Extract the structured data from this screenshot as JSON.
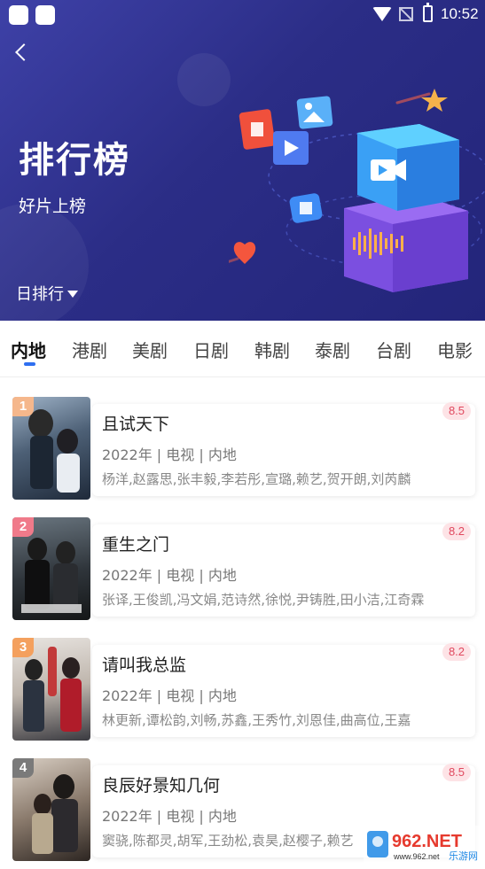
{
  "status_bar": {
    "time": "10:52"
  },
  "header": {
    "title": "排行榜",
    "subtitle": "好片上榜",
    "period_selector": "日排行"
  },
  "tabs": [
    {
      "label": "内地",
      "active": true
    },
    {
      "label": "港剧",
      "active": false
    },
    {
      "label": "美剧",
      "active": false
    },
    {
      "label": "日剧",
      "active": false
    },
    {
      "label": "韩剧",
      "active": false
    },
    {
      "label": "泰剧",
      "active": false
    },
    {
      "label": "台剧",
      "active": false
    },
    {
      "label": "电影",
      "active": false
    }
  ],
  "list": [
    {
      "rank": "1",
      "title": "且试天下",
      "meta": "2022年 | 电视 | 内地",
      "cast": "杨洋,赵露思,张丰毅,李若彤,宣璐,赖艺,贺开朗,刘芮麟",
      "score": "8.5"
    },
    {
      "rank": "2",
      "title": "重生之门",
      "meta": "2022年 | 电视 | 内地",
      "cast": "张译,王俊凯,冯文娟,范诗然,徐悦,尹铸胜,田小洁,江奇霖",
      "score": "8.2"
    },
    {
      "rank": "3",
      "title": "请叫我总监",
      "meta": "2022年 | 电视 | 内地",
      "cast": "林更新,谭松韵,刘畅,苏鑫,王秀竹,刘恩佳,曲高位,王嘉",
      "score": "8.2"
    },
    {
      "rank": "4",
      "title": "良辰好景知几何",
      "meta": "2022年 | 电视 | 内地",
      "cast": "窦骁,陈都灵,胡军,王劲松,袁昊,赵樱子,赖艺",
      "score": "8.5"
    }
  ],
  "watermark": {
    "text": "962.NET",
    "sub": "乐游网",
    "url": "www.962.net"
  },
  "colors": {
    "banner": "#2b2d86",
    "accent": "#2f6ff0",
    "score_bg": "#fde3e6",
    "score_text": "#e0495f"
  }
}
